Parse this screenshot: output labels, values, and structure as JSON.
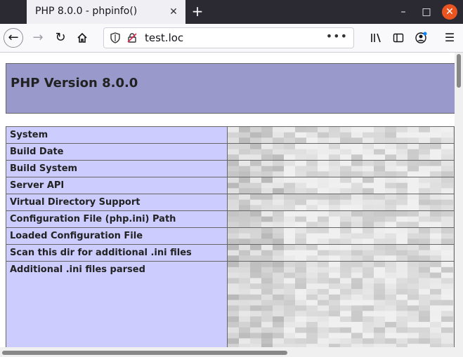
{
  "browser": {
    "tab_title": "PHP 8.0.0 - phpinfo()",
    "url": "test.loc"
  },
  "page": {
    "heading": "PHP Version 8.0.0",
    "rows": [
      {
        "label": "System"
      },
      {
        "label": "Build Date"
      },
      {
        "label": "Build System"
      },
      {
        "label": "Server API"
      },
      {
        "label": "Virtual Directory Support"
      },
      {
        "label": "Configuration File (php.ini) Path"
      },
      {
        "label": "Loaded Configuration File"
      },
      {
        "label": "Scan this dir for additional .ini files"
      },
      {
        "label": "Additional .ini files parsed"
      }
    ]
  },
  "colors": {
    "header_bg": "#9999cc",
    "label_bg": "#ccccff",
    "close_btn": "#e95420"
  }
}
